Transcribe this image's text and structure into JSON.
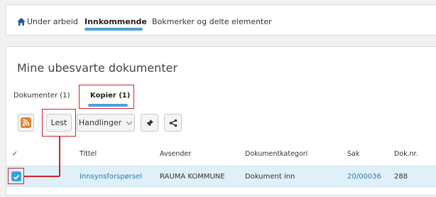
{
  "topnav": {
    "items": [
      {
        "label": "Under arbeid",
        "active": false
      },
      {
        "label": "Innkommende",
        "active": true
      },
      {
        "label": "Bokmerker og delte elementer",
        "active": false
      }
    ]
  },
  "panel": {
    "title": "Mine ubesvarte dokumenter",
    "subtabs": [
      {
        "label": "Dokumenter (1)",
        "active": false
      },
      {
        "label": "Kopier (1)",
        "active": true
      }
    ]
  },
  "toolbar": {
    "rss_icon": "rss-icon",
    "lest_label": "Lest",
    "handlinger_label": "Handlinger",
    "pin_icon": "pin-icon",
    "share_icon": "share-icon"
  },
  "table": {
    "check_header": "✓",
    "columns": [
      "Tittel",
      "Avsender",
      "Dokumentkategori",
      "Sak",
      "Dok.nr."
    ],
    "rows": [
      {
        "checked": true,
        "tittel": "Innsynsforspørsel",
        "avsender": "RAUMA KOMMUNE",
        "dokumentkategori": "Dokument inn",
        "sak": "20/00036",
        "doknr": "288"
      }
    ]
  },
  "colors": {
    "accent": "#4aa0d8",
    "highlight": "#d0212c",
    "selected_row": "#dff0f8",
    "link": "#2a7ab8",
    "rss": "#e2862a"
  }
}
